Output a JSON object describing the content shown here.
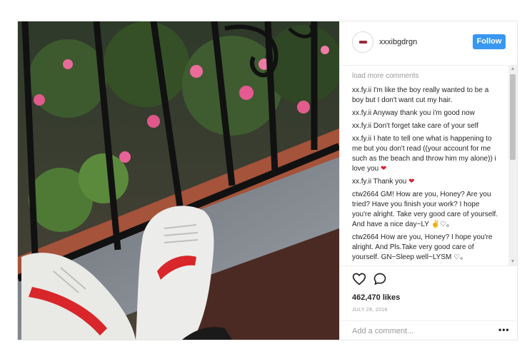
{
  "post": {
    "username": "xxxibgdrgn",
    "follow_label": "Follow",
    "load_more": "load more comments",
    "comments": [
      {
        "user": "xx.fy.ii",
        "text": "I'm like the boy really wanted to be a boy but I don't want cut my hair.",
        "emoji": ""
      },
      {
        "user": "xx.fy.ii",
        "text": "Anyway thank you i'm good now",
        "emoji": ""
      },
      {
        "user": "xx.fy.ii",
        "text": "Don't forget take care of your self",
        "emoji": ""
      },
      {
        "user": "xx.fy.ii",
        "text": "I hate to tell one what is happening to me but you don't read ((your account for me such as the beach and throw him my alone)) i love you",
        "emoji": "❤"
      },
      {
        "user": "xx.fy.ii",
        "text": "Thank you",
        "emoji": "❤"
      },
      {
        "user": "ctw2664",
        "text": "GM! How are you, Honey? Are you tried? Have you finish your work? I hope you're alright. Take very good care of yourself. And have a nice day~LY",
        "emoji": "✌♡。"
      },
      {
        "user": "ctw2664",
        "text": "How are you, Honey? I hope you're alright. And Pls.Take very good care of yourself. GN~Sleep well~LYSM",
        "emoji": "♡。"
      }
    ],
    "likes": "462,470 likes",
    "date": "JULY 28, 2016",
    "add_comment_placeholder": "Add a comment...",
    "more_label": "•••"
  },
  "icons": {
    "like": "heart-outline-icon",
    "comment": "speech-bubble-icon"
  },
  "colors": {
    "follow_button": "#3897f0",
    "avatar_mark": "#9c2a3d",
    "shoe_stripe": "#d8262a"
  }
}
